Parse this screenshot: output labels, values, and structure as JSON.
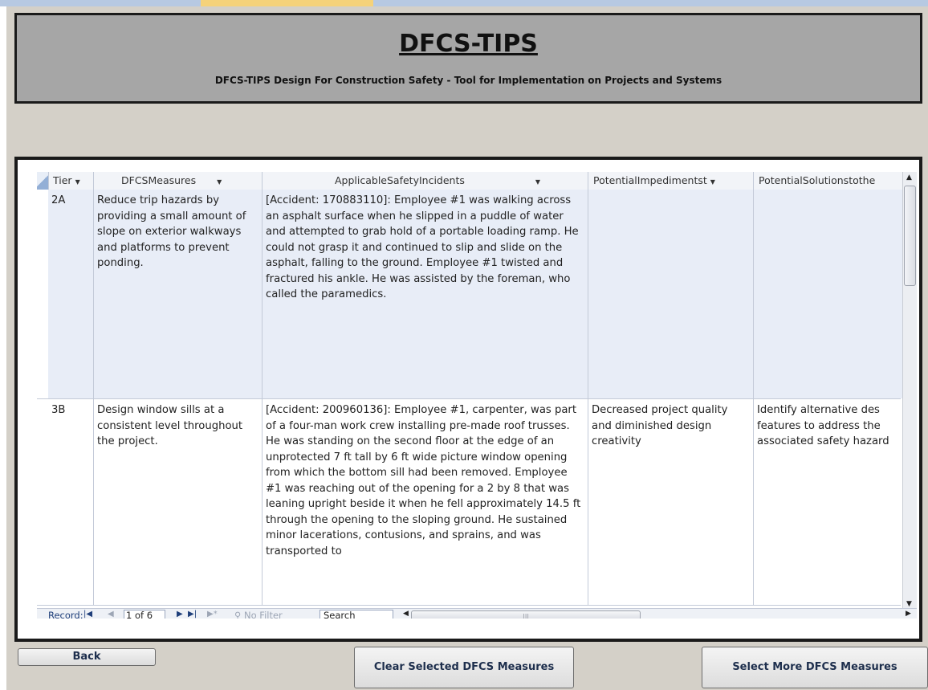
{
  "header": {
    "title": "DFCS-TIPS",
    "subtitle": "DFCS-TIPS Design For Construction Safety - Tool for Implementation on Projects and Systems"
  },
  "table": {
    "columns": [
      "Tier",
      "DFCSMeasures",
      "ApplicableSafetyIncidents",
      "PotentialImpedimentst",
      "PotentialSolutionstothe"
    ],
    "rows": [
      {
        "tier": "2A",
        "measure": "Reduce trip hazards by providing a small amount of slope on exterior walkways and platforms to prevent ponding.",
        "incident": "[Accident: 170883110]: Employee #1 was walking across an asphalt surface when he slipped in a puddle of water and attempted to grab hold of a portable loading ramp. He could not grasp it and continued to slip and slide on the asphalt, falling to the ground. Employee #1 twisted and fractured his ankle. He was assisted by the foreman, who called the paramedics.",
        "impediments": "",
        "solutions": ""
      },
      {
        "tier": "3B",
        "measure": "Design window sills at a consistent level throughout the project.",
        "incident": "[Accident: 200960136]: Employee #1, carpenter, was part of a four-man work crew installing pre-made roof trusses. He was standing on the second floor at the edge of an unprotected 7 ft tall by 6 ft wide picture window opening from which the bottom sill had been removed. Employee #1 was reaching out of the opening for a 2 by 8 that was leaning upright beside it when he fell approximately 14.5 ft through the opening to the sloping ground. He sustained minor lacerations, contusions, and sprains, and was transported to",
        "impediments": "Decreased project quality and diminished design creativity",
        "solutions": "Identify alternative des features to address the associated safety hazard"
      }
    ]
  },
  "navigation": {
    "record_label": "Record:",
    "record_value": "1 of 6",
    "filter_label": "No Filter",
    "search_placeholder": "Search"
  },
  "buttons": {
    "back": "Back",
    "clear": "Clear Selected DFCS Measures",
    "more": "Select More DFCS Measures"
  }
}
